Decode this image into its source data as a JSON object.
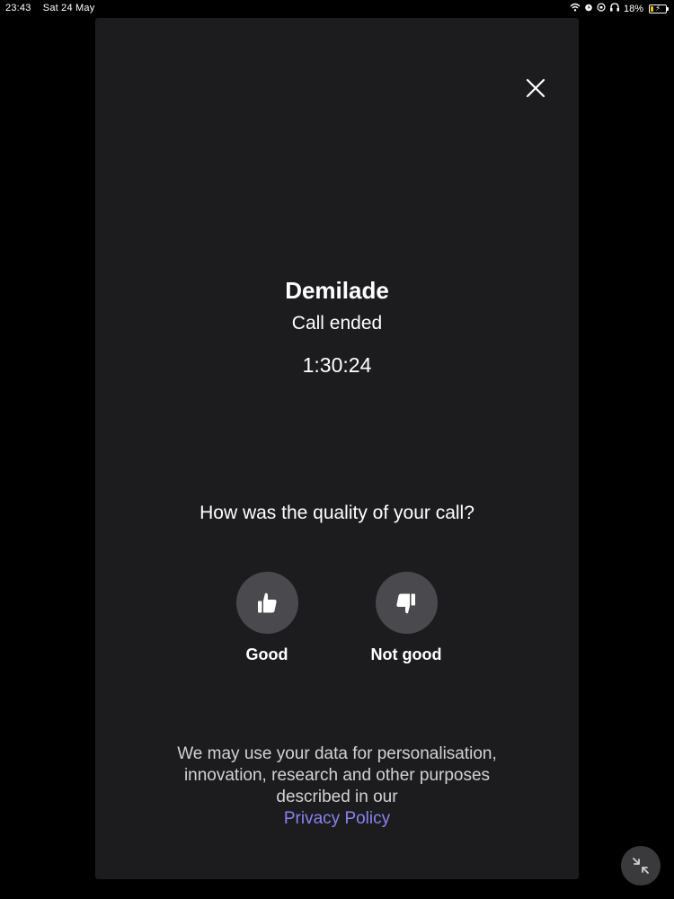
{
  "status_bar": {
    "time": "23:43",
    "date": "Sat 24 May",
    "battery_percent": "18%",
    "battery_level": 0.18,
    "charging": true,
    "icons": [
      "wifi-icon",
      "alarm-icon",
      "lock-rotation-icon",
      "headphones-icon",
      "battery-icon"
    ]
  },
  "call_summary": {
    "caller_name": "Demilade",
    "status": "Call ended",
    "duration": "1:30:24"
  },
  "feedback": {
    "question": "How was the quality of your call?",
    "good_label": "Good",
    "not_good_label": "Not good"
  },
  "disclaimer": {
    "line1": "We may use your data for personalisation,",
    "line2": "innovation, research and other purposes",
    "line3": "described in our",
    "link_text": "Privacy Policy"
  },
  "colors": {
    "background": "#000000",
    "panel": "#1c1c1e",
    "button_circle": "#4a4a4e",
    "link": "#8a83f0",
    "battery_fill": "#f2c200"
  }
}
